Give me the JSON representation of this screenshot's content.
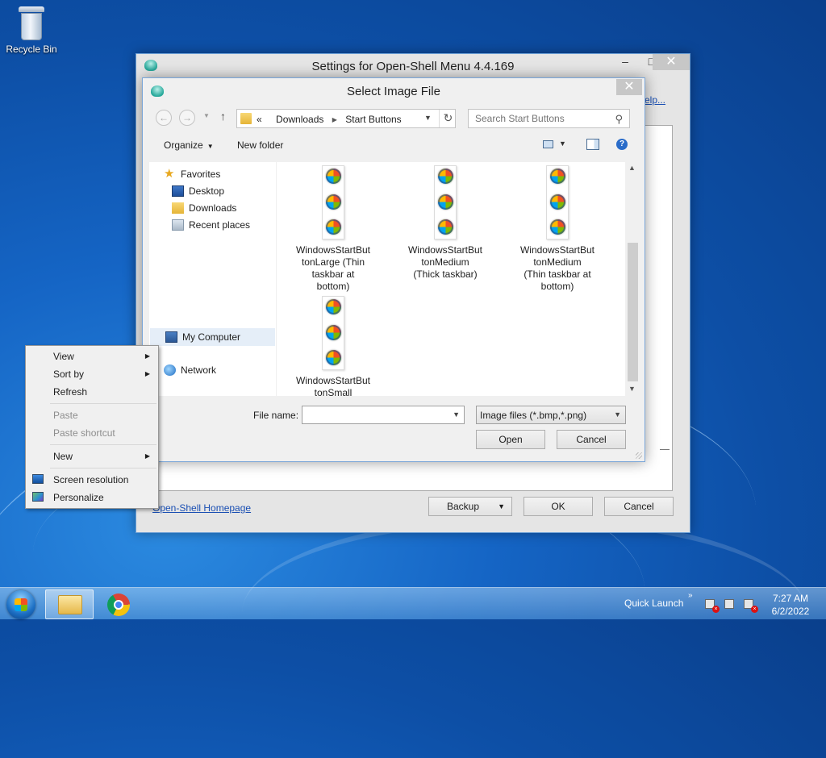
{
  "desktop": {
    "recycle_bin_label": "Recycle Bin"
  },
  "settings_window": {
    "title": "Settings for Open-Shell Menu 4.4.169",
    "help_link": "elp...",
    "homepage_link": "Open-Shell Homepage",
    "backup_label": "Backup",
    "ok_label": "OK",
    "cancel_label": "Cancel",
    "close_glyph": "✕",
    "minimize_glyph": "–",
    "maximize_glyph": "□"
  },
  "dialog": {
    "title": "Select Image File",
    "close_glyph": "✕",
    "breadcrumb": {
      "prefix": "«",
      "items": [
        "Downloads",
        "Start Buttons"
      ]
    },
    "search_placeholder": "Search Start Buttons",
    "toolbar": {
      "organize": "Organize",
      "new_folder": "New folder"
    },
    "nav": {
      "favorites": "Favorites",
      "desktop": "Desktop",
      "downloads": "Downloads",
      "recent_places": "Recent places",
      "my_computer": "My Computer",
      "network": "Network"
    },
    "files": [
      {
        "name_line1": "WindowsStartBut",
        "name_line2": "tonLarge (Thin",
        "name_line3": "taskbar at",
        "name_line4": "bottom)"
      },
      {
        "name_line1": "WindowsStartBut",
        "name_line2": "tonMedium",
        "name_line3": "(Thick taskbar)",
        "name_line4": ""
      },
      {
        "name_line1": "WindowsStartBut",
        "name_line2": "tonMedium",
        "name_line3": "(Thin taskbar at",
        "name_line4": "bottom)"
      },
      {
        "name_line1": "WindowsStartBut",
        "name_line2": "tonSmall",
        "name_line3": "",
        "name_line4": ""
      }
    ],
    "file_name_label": "File name:",
    "file_name_value": "",
    "filter_value": "Image files (*.bmp,*.png)",
    "open_label": "Open",
    "cancel_label": "Cancel"
  },
  "context_menu": {
    "items": [
      {
        "label": "View",
        "submenu": true,
        "enabled": true
      },
      {
        "label": "Sort by",
        "submenu": true,
        "enabled": true
      },
      {
        "label": "Refresh",
        "submenu": false,
        "enabled": true
      },
      {
        "label": "Paste",
        "submenu": false,
        "enabled": false
      },
      {
        "label": "Paste shortcut",
        "submenu": false,
        "enabled": false
      },
      {
        "label": "New",
        "submenu": true,
        "enabled": true
      },
      {
        "label": "Screen resolution",
        "submenu": false,
        "enabled": true,
        "icon": "screen-resolution-icon"
      },
      {
        "label": "Personalize",
        "submenu": false,
        "enabled": true,
        "icon": "personalize-icon"
      }
    ]
  },
  "taskbar": {
    "quick_launch": "Quick Launch",
    "time": "7:27 AM",
    "date": "6/2/2022"
  }
}
